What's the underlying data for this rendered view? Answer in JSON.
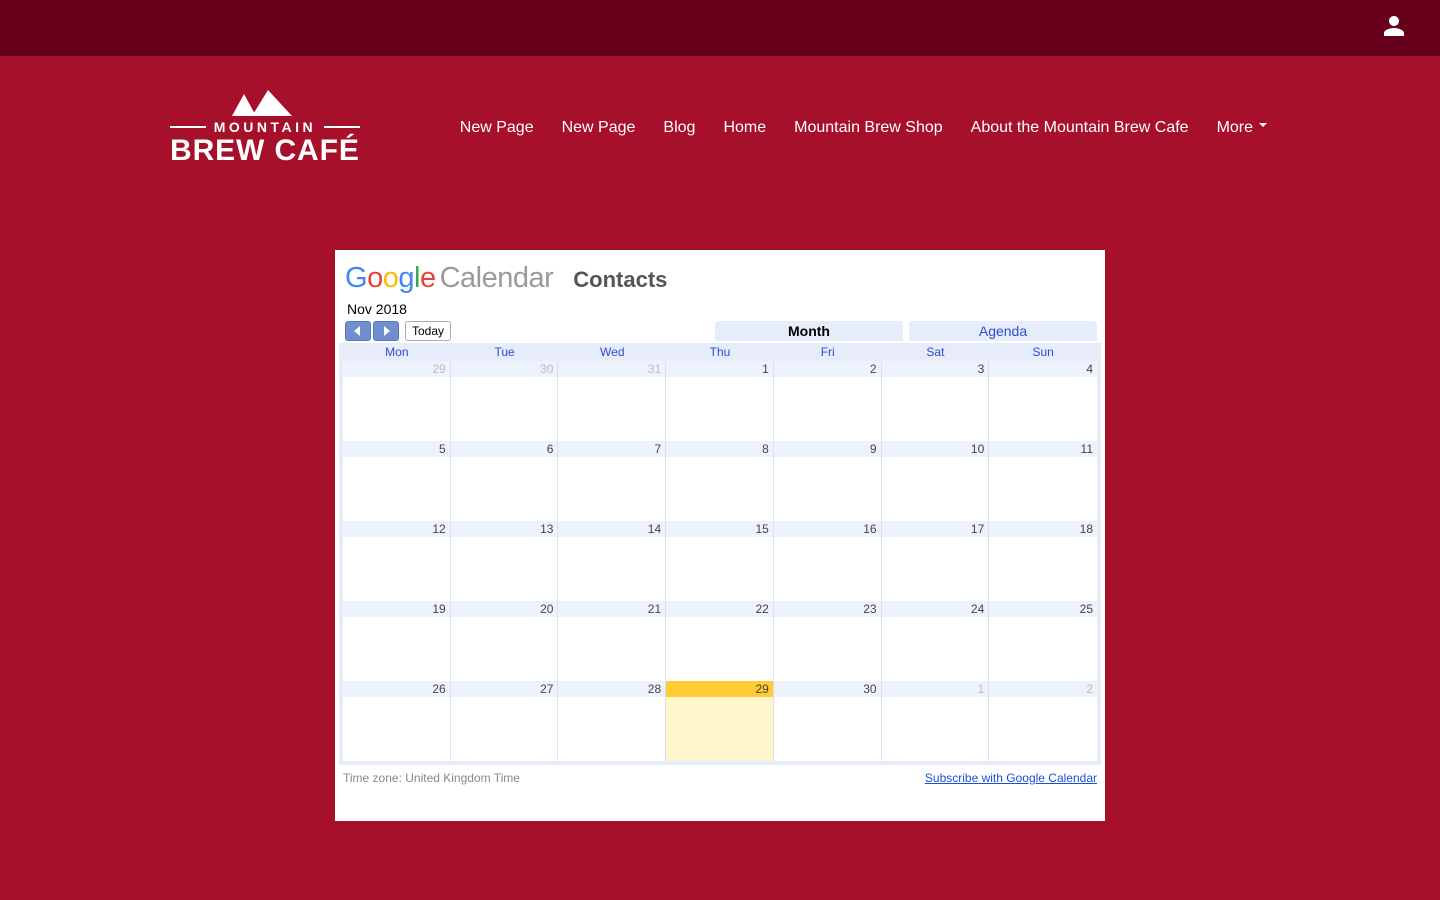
{
  "logo": {
    "line1": "MOUNTAIN",
    "line2": "BREW CAFÉ"
  },
  "nav": {
    "items": [
      "New Page",
      "New Page",
      "Blog",
      "Home",
      "Mountain Brew Shop",
      "About the Mountain Brew Cafe",
      "More"
    ]
  },
  "calendar": {
    "brand_word": "Calendar",
    "contacts": "Contacts",
    "month_label": "Nov 2018",
    "today_label": "Today",
    "views": {
      "month": "Month",
      "agenda": "Agenda"
    },
    "dow": [
      "Mon",
      "Tue",
      "Wed",
      "Thu",
      "Fri",
      "Sat",
      "Sun"
    ],
    "weeks": [
      [
        {
          "n": "29",
          "other": true
        },
        {
          "n": "30",
          "other": true
        },
        {
          "n": "31",
          "other": true
        },
        {
          "n": "1"
        },
        {
          "n": "2"
        },
        {
          "n": "3"
        },
        {
          "n": "4"
        }
      ],
      [
        {
          "n": "5"
        },
        {
          "n": "6"
        },
        {
          "n": "7"
        },
        {
          "n": "8"
        },
        {
          "n": "9"
        },
        {
          "n": "10"
        },
        {
          "n": "11"
        }
      ],
      [
        {
          "n": "12"
        },
        {
          "n": "13"
        },
        {
          "n": "14"
        },
        {
          "n": "15"
        },
        {
          "n": "16"
        },
        {
          "n": "17"
        },
        {
          "n": "18"
        }
      ],
      [
        {
          "n": "19"
        },
        {
          "n": "20"
        },
        {
          "n": "21"
        },
        {
          "n": "22"
        },
        {
          "n": "23"
        },
        {
          "n": "24"
        },
        {
          "n": "25"
        }
      ],
      [
        {
          "n": "26"
        },
        {
          "n": "27"
        },
        {
          "n": "28"
        },
        {
          "n": "29",
          "today": true
        },
        {
          "n": "30"
        },
        {
          "n": "1",
          "other": true
        },
        {
          "n": "2",
          "other": true
        }
      ]
    ],
    "tz": "Time zone: United Kingdom Time",
    "subscribe": "Subscribe with Google Calendar"
  }
}
